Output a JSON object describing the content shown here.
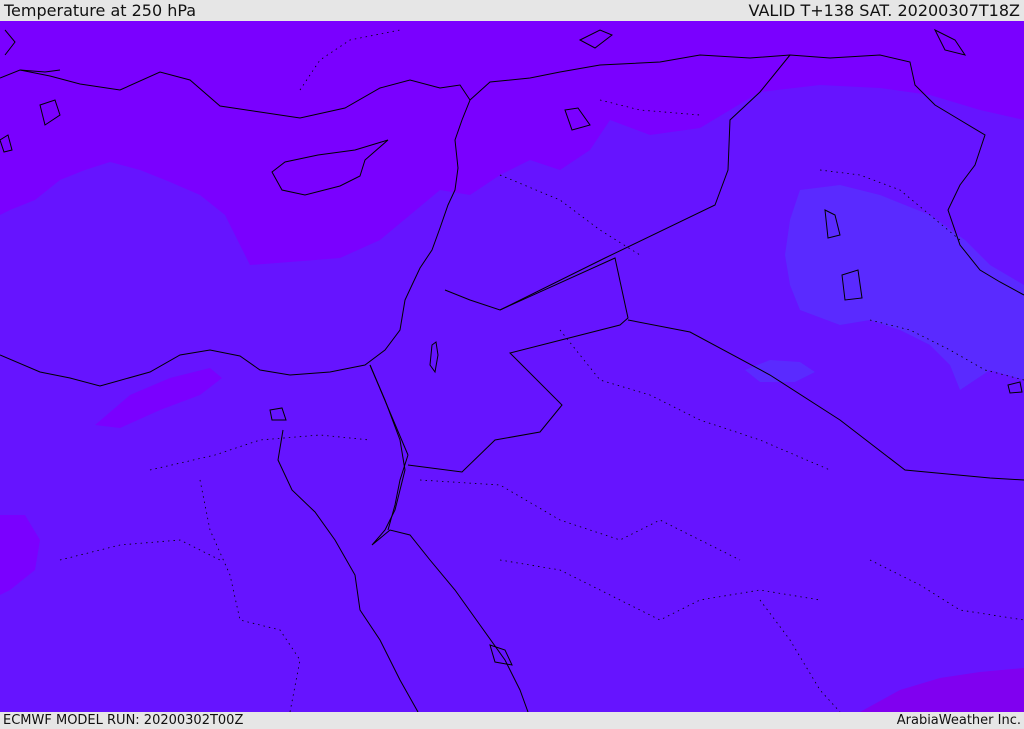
{
  "header": {
    "title": "Temperature at 250 hPa",
    "valid": "VALID T+138 SAT. 20200307T18Z"
  },
  "footer": {
    "model_run": "ECMWF MODEL RUN: 20200302T00Z",
    "credit": "ArabiaWeather Inc."
  },
  "colors": {
    "band_cold": "#7a00ff",
    "band_mid": "#6614ff",
    "band_blue": "#5a2aff",
    "band_warm": "#8000f0",
    "boundary": "#000000"
  }
}
